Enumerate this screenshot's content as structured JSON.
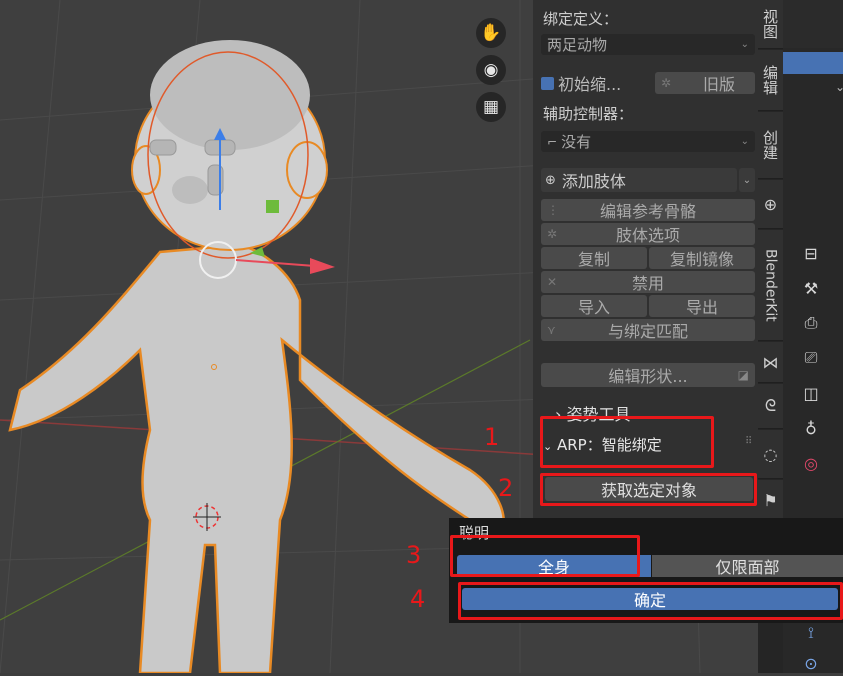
{
  "colors": {
    "accent_blue": "#4772b3",
    "annotation_red": "#e8181a",
    "panel_bg": "#303030"
  },
  "viewport": {
    "nav_icons": [
      "hand-icon",
      "camera-icon",
      "grid-icon"
    ],
    "figure_label": "character model with armature gizmos"
  },
  "panel": {
    "rig_definition_label": "绑定定义：",
    "rig_definition_value": "两足动物",
    "initial_checkbox_label": "初始缩...",
    "legacy_label": "旧版",
    "helper_controllers_label": "辅助控制器：",
    "helper_controllers_value": "没有",
    "add_limb_label": "添加肢体",
    "edit_reference_bones": "编辑参考骨骼",
    "limb_options": "肢体选项",
    "copy": "复制",
    "copy_mirror": "复制镜像",
    "disable": "禁用",
    "import": "导入",
    "export": "导出",
    "match_to_rig": "与绑定匹配",
    "edit_shape": "编辑形状...",
    "pose_tools": "姿势工具",
    "arp_smart": "ARP：智能绑定",
    "get_selected": "获取选定对象"
  },
  "tabs": [
    "视图",
    "编辑",
    "创建",
    "BlenderKit"
  ],
  "popup": {
    "title": "聪明",
    "full_body": "全身",
    "face_only": "仅限面部",
    "confirm": "确定"
  },
  "annotations": [
    "1",
    "2",
    "3",
    "4"
  ]
}
